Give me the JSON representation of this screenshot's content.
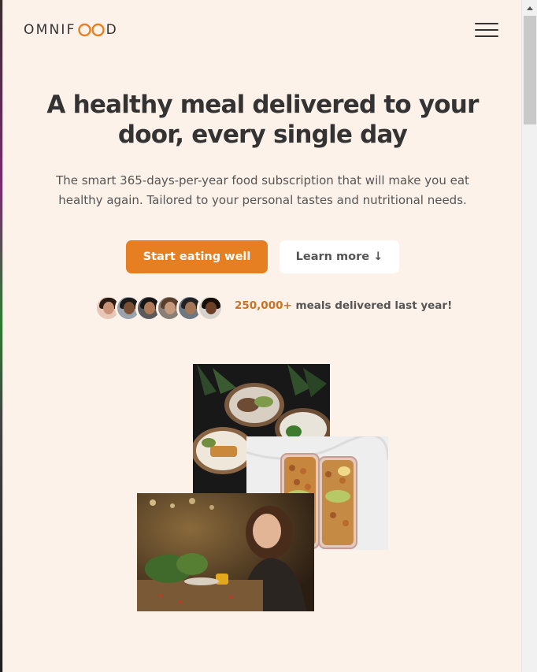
{
  "header": {
    "logo_text_left": "OMNIF",
    "logo_text_right": "D",
    "logo_icon": "infinity-oo-icon",
    "menu_icon": "hamburger-menu-icon"
  },
  "hero": {
    "headline": "A healthy meal delivered to your door, every single day",
    "description": "The smart 365-days-per-year food subscription that will make you eat healthy again. Tailored to your personal tastes and nutritional needs.",
    "primary_button": "Start eating well",
    "secondary_button": "Learn more ↓"
  },
  "delivered": {
    "count": "250,000+",
    "text": " meals delivered last year!",
    "avatars": [
      "customer-1",
      "customer-2",
      "customer-3",
      "customer-4",
      "customer-5",
      "customer-6"
    ]
  },
  "photos": [
    "food-bowls-photo",
    "meal-prep-containers-photo",
    "woman-eating-photo"
  ],
  "colors": {
    "background": "#fdf2e9",
    "accent": "#e67e22",
    "accent_text": "#cf711f",
    "text_dark": "#333333",
    "text_body": "#555555"
  }
}
